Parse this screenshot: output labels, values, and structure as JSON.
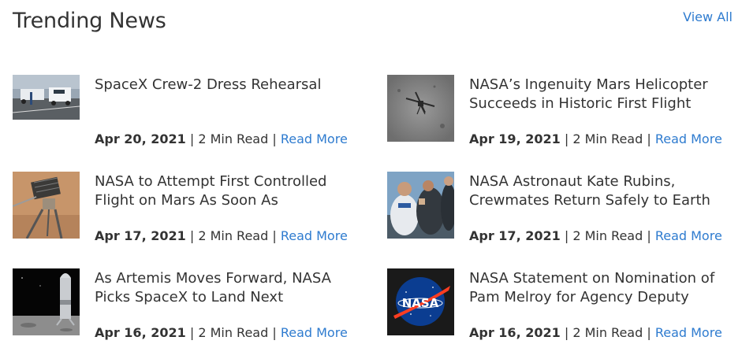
{
  "header": {
    "title": "Trending News",
    "view_all": "View All"
  },
  "items": [
    {
      "headline": "SpaceX Crew-2 Dress Rehearsal",
      "date": "Apr 20, 2021",
      "read_time": "2 Min Read",
      "read_more": "Read More",
      "thumb_icon": "crew-vehicles-photo"
    },
    {
      "headline": "NASA’s Ingenuity Mars Helicopter Succeeds in Historic First Flight",
      "date": "Apr 19, 2021",
      "read_time": "2 Min Read",
      "read_more": "Read More",
      "thumb_icon": "helicopter-shadow-photo"
    },
    {
      "headline": "NASA to Attempt First Controlled Flight on Mars As Soon As",
      "date": "Apr 17, 2021",
      "read_time": "2 Min Read",
      "read_more": "Read More",
      "thumb_icon": "mars-helicopter-photo"
    },
    {
      "headline": "NASA Astronaut Kate Rubins, Crewmates Return Safely to Earth",
      "date": "Apr 17, 2021",
      "read_time": "2 Min Read",
      "read_more": "Read More",
      "thumb_icon": "astronaut-landing-photo"
    },
    {
      "headline": "As Artemis Moves Forward, NASA Picks SpaceX to Land Next",
      "date": "Apr 16, 2021",
      "read_time": "2 Min Read",
      "read_more": "Read More",
      "thumb_icon": "starship-lunar-photo"
    },
    {
      "headline": "NASA Statement on Nomination of Pam Melroy for Agency Deputy",
      "date": "Apr 16, 2021",
      "read_time": "2 Min Read",
      "read_more": "Read More",
      "thumb_icon": "nasa-logo",
      "logo_text": "NASA"
    }
  ]
}
